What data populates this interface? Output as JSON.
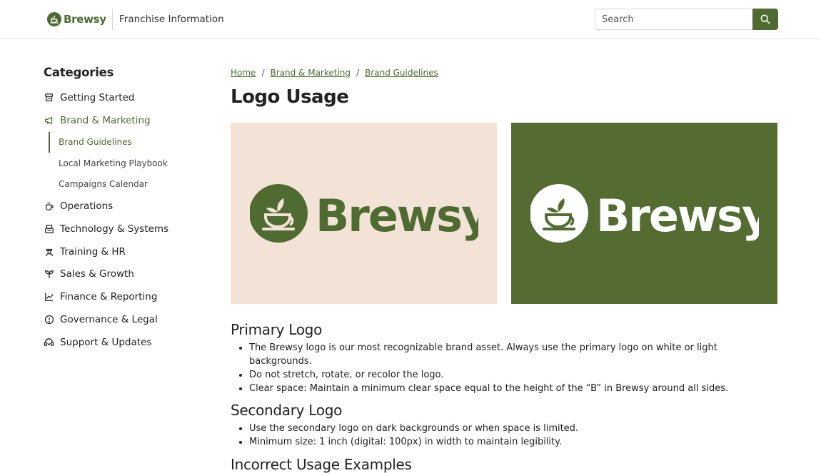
{
  "header": {
    "brand_name": "Brewsy",
    "title": "Franchise Information",
    "search_placeholder": "Search"
  },
  "colors": {
    "brand_green": "#4f6b32",
    "light_bg": "#f3e3d7",
    "dark_bg": "#546b32"
  },
  "sidebar": {
    "heading": "Categories",
    "items": [
      {
        "label": "Getting Started",
        "icon": "cups-stack-icon"
      },
      {
        "label": "Brand & Marketing",
        "icon": "megaphone-icon",
        "active": true
      },
      {
        "label": "Operations",
        "icon": "coffee-cup-icon"
      },
      {
        "label": "Technology & Systems",
        "icon": "register-icon"
      },
      {
        "label": "Training & HR",
        "icon": "barista-icon"
      },
      {
        "label": "Sales & Growth",
        "icon": "sprout-icon"
      },
      {
        "label": "Finance & Reporting",
        "icon": "line-chart-icon"
      },
      {
        "label": "Governance & Legal",
        "icon": "alert-circle-icon"
      },
      {
        "label": "Support & Updates",
        "icon": "support-headset-icon"
      }
    ],
    "subitems": [
      {
        "label": "Brand Guidelines",
        "active": true
      },
      {
        "label": "Local Marketing Playbook"
      },
      {
        "label": "Campaigns Calendar"
      }
    ]
  },
  "breadcrumb": [
    "Home",
    "Brand & Marketing",
    "Brand Guidelines"
  ],
  "page_title": "Logo Usage",
  "logos": {
    "primary_text": "Brewsy",
    "secondary_text": "Brewsy"
  },
  "sections": {
    "primary": {
      "title": "Primary Logo",
      "bullets": [
        "The Brewsy logo is our most recognizable brand asset. Always use the primary logo on white or light backgrounds.",
        "Do not stretch, rotate, or recolor the logo.",
        "Clear space: Maintain a minimum clear space equal to the height of the “B” in Brewsy around all sides."
      ]
    },
    "secondary": {
      "title": "Secondary Logo",
      "bullets": [
        "Use the secondary logo on dark backgrounds or when space is limited.",
        "Minimum size: 1 inch (digital: 100px) in width to maintain legibility."
      ]
    },
    "incorrect": {
      "title": "Incorrect Usage Examples"
    }
  }
}
